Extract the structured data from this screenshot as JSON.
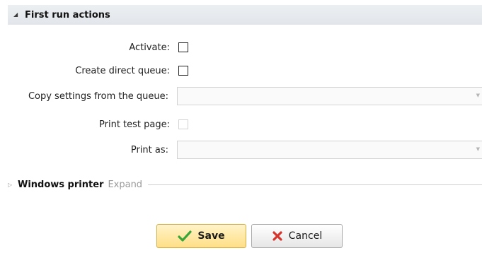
{
  "section": {
    "title": "First run actions"
  },
  "fields": {
    "activate": {
      "label": "Activate:"
    },
    "create_direct_queue": {
      "label": "Create direct queue:"
    },
    "copy_settings": {
      "label": "Copy settings from the queue:",
      "value": ""
    },
    "print_test_page": {
      "label": "Print test page:"
    },
    "print_as": {
      "label": "Print as:",
      "value": ""
    }
  },
  "windows_printer": {
    "title": "Windows printer",
    "expand_label": "Expand"
  },
  "buttons": {
    "save_label": "Save",
    "cancel_label": "Cancel"
  },
  "colors": {
    "save_icon": "#3aa63a",
    "cancel_icon": "#d9342b"
  },
  "icons": {
    "save": "check-icon",
    "cancel": "x-icon"
  }
}
